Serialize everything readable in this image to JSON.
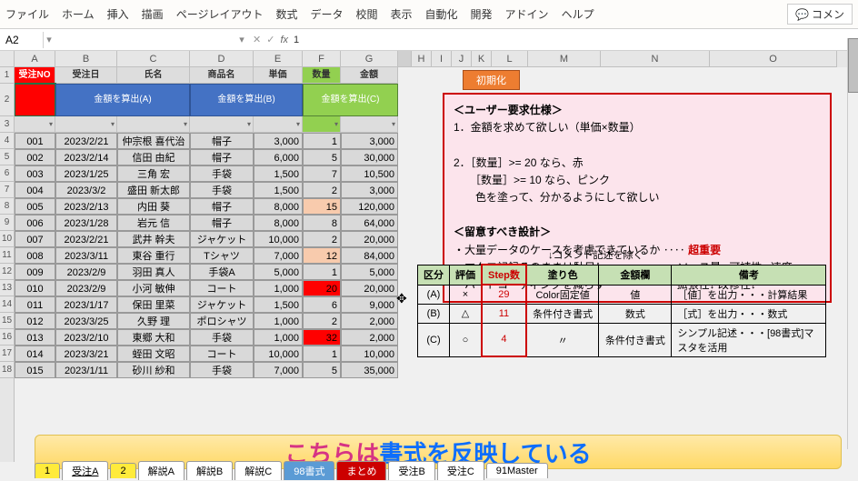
{
  "ribbon": {
    "items": [
      "ファイル",
      "ホーム",
      "挿入",
      "描画",
      "ページレイアウト",
      "数式",
      "データ",
      "校閲",
      "表示",
      "自動化",
      "開発",
      "アドイン",
      "ヘルプ"
    ],
    "comment": "コメン"
  },
  "formula": {
    "name": "A2",
    "value": "1"
  },
  "cols_left": {
    "A": 45,
    "B": 68,
    "C": 80,
    "D": 70,
    "E": 54,
    "F": 42,
    "G": 63
  },
  "cols_right": {
    "H": 22,
    "I": 22,
    "J": 22,
    "K": 22,
    "L": 40,
    "M": 80,
    "N": 120,
    "O": 140
  },
  "headers": {
    "A": "受注NO",
    "B": "受注日",
    "C": "氏名",
    "D": "商品名",
    "E": "単価",
    "F": "数量",
    "G": "金額"
  },
  "btns": {
    "a": "金額を算出(A)",
    "b": "金額を算出(B)",
    "c": "金額を算出(C)",
    "init": "初期化"
  },
  "rows": [
    {
      "no": "001",
      "date": "2023/2/21",
      "name": "仲宗根 喜代治",
      "item": "帽子",
      "price": "3,000",
      "qty": "1",
      "amt": "3,000",
      "qc": ""
    },
    {
      "no": "002",
      "date": "2023/2/14",
      "name": "信田 由紀",
      "item": "帽子",
      "price": "6,000",
      "qty": "5",
      "amt": "30,000",
      "qc": ""
    },
    {
      "no": "003",
      "date": "2023/1/25",
      "name": "三角 宏",
      "item": "手袋",
      "price": "1,500",
      "qty": "7",
      "amt": "10,500",
      "qc": ""
    },
    {
      "no": "004",
      "date": "2023/3/2",
      "name": "盛田 新太郎",
      "item": "手袋",
      "price": "1,500",
      "qty": "2",
      "amt": "3,000",
      "qc": ""
    },
    {
      "no": "005",
      "date": "2023/2/13",
      "name": "内田 葵",
      "item": "帽子",
      "price": "8,000",
      "qty": "15",
      "amt": "120,000",
      "qc": "pink"
    },
    {
      "no": "006",
      "date": "2023/1/28",
      "name": "岩元 信",
      "item": "帽子",
      "price": "8,000",
      "qty": "8",
      "amt": "64,000",
      "qc": ""
    },
    {
      "no": "007",
      "date": "2023/2/21",
      "name": "武井 幹夫",
      "item": "ジャケット",
      "price": "10,000",
      "qty": "2",
      "amt": "20,000",
      "qc": ""
    },
    {
      "no": "008",
      "date": "2023/3/11",
      "name": "東谷 重行",
      "item": "Tシャツ",
      "price": "7,000",
      "qty": "12",
      "amt": "84,000",
      "qc": "pink"
    },
    {
      "no": "009",
      "date": "2023/2/9",
      "name": "羽田 真人",
      "item": "手袋A",
      "price": "5,000",
      "qty": "1",
      "amt": "5,000",
      "qc": ""
    },
    {
      "no": "010",
      "date": "2023/2/9",
      "name": "小河 敏伸",
      "item": "コート",
      "price": "1,000",
      "qty": "20",
      "amt": "20,000",
      "qc": "redbg"
    },
    {
      "no": "011",
      "date": "2023/1/17",
      "name": "保田 里菜",
      "item": "ジャケット",
      "price": "1,500",
      "qty": "6",
      "amt": "9,000",
      "qc": ""
    },
    {
      "no": "012",
      "date": "2023/3/25",
      "name": "久野 理",
      "item": "ポロシャツ",
      "price": "1,000",
      "qty": "2",
      "amt": "2,000",
      "qc": ""
    },
    {
      "no": "013",
      "date": "2023/2/10",
      "name": "東郷 大和",
      "item": "手袋",
      "price": "1,000",
      "qty": "32",
      "amt": "2,000",
      "qc": "redbg"
    },
    {
      "no": "014",
      "date": "2023/3/21",
      "name": "蛭田 文昭",
      "item": "コート",
      "price": "10,000",
      "qty": "1",
      "amt": "10,000",
      "qc": ""
    },
    {
      "no": "015",
      "date": "2023/1/11",
      "name": "砂川 紗和",
      "item": "手袋",
      "price": "7,000",
      "qty": "5",
      "amt": "35,000",
      "qc": ""
    }
  ],
  "note": {
    "t1": "＜ユーザー要求仕様＞",
    "l1": "1．金額を求めて欲しい（単価×数量）",
    "l2": "2．［数量］>= 20 なら、赤",
    "l3": "　　［数量］>= 10 なら、ピンク",
    "l4": "　　色を塗って、分かるようにして欲しい",
    "t2": "＜留意すべき設計＞",
    "l5": "・大量データのケースを考慮できているか ‥‥ ",
    "l5b": "超重要",
    "l6": "・マクロ記録そのままは駄目！ ‥‥‥‥‥‥ ソース量↑ 可読性↓ 速度↓",
    "l7": "・ハードコーディングを減らす ‥‥‥‥‥‥ 拡張性↓ 改修性↓"
  },
  "cmt": "↓コメント記述を除く",
  "tbl2": {
    "hdr": [
      "区分",
      "評価",
      "Step数",
      "塗り色",
      "金額欄",
      "備考"
    ],
    "r": [
      [
        "(A)",
        "×",
        "29",
        "Color固定値",
        "値",
        "［値］を出力・・・計算結果"
      ],
      [
        "(B)",
        "△",
        "11",
        "条件付き書式",
        "数式",
        "［式］を出力・・・数式"
      ],
      [
        "(C)",
        "○",
        "4",
        "〃",
        "条件付き書式",
        "シンプル記述・・・[98書式]マスタを活用"
      ]
    ]
  },
  "banner": {
    "a": "こちらは",
    "b": "書式を反映している"
  },
  "tabs": [
    "1",
    "受注A",
    "2",
    "解説A",
    "解説B",
    "解説C",
    "98書式",
    "まとめ",
    "受注B",
    "受注C",
    "91Master"
  ]
}
